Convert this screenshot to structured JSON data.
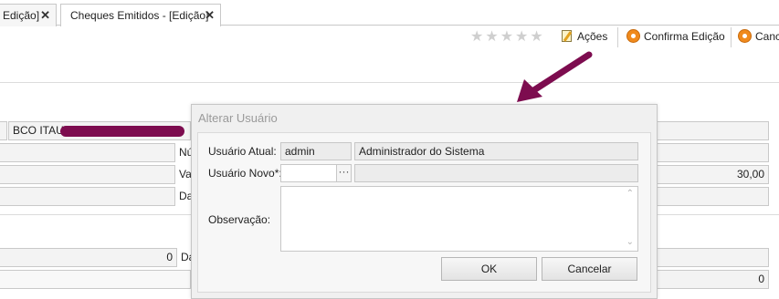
{
  "tabs": [
    {
      "label": "Edição]",
      "close": "✕"
    },
    {
      "label": "Cheques Emitidos - [Edição]",
      "close": "✕"
    }
  ],
  "toolbar": {
    "rating_stars": [
      "★",
      "★",
      "★",
      "★",
      "★"
    ],
    "acoes_label": "Ações",
    "confirma_label": "Confirma Edição",
    "cancela_label": "Canc"
  },
  "form": {
    "banco_value": "BCO ITAU A",
    "label_nu": "Nú",
    "label_va": "Va",
    "label_da": "Da",
    "label_da2": "Da",
    "valor_value": "30,00",
    "field_zero1": "0",
    "field_zero2": "0"
  },
  "dialog": {
    "title": "Alterar Usuário",
    "usuario_atual_label": "Usuário Atual:",
    "usuario_atual_login": "admin",
    "usuario_atual_nome": "Administrador do Sistema",
    "usuario_novo_label": "Usuário Novo*:",
    "usuario_novo_login": "",
    "usuario_novo_nome": "",
    "ellipsis_label": "···",
    "observacao_label": "Observação:",
    "observacao_value": "",
    "ok_label": "OK",
    "cancelar_label": "Cancelar",
    "scroll_up": "⌃",
    "scroll_down": "⌄"
  },
  "annotation": {
    "arrow_color": "#7d0c4f"
  }
}
